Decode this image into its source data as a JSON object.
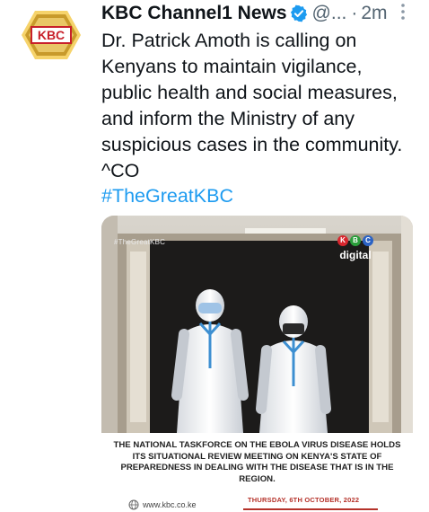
{
  "tweet": {
    "avatar_label": "KBC",
    "display_name": "KBC Channel1 News",
    "handle": "@...",
    "separator": "·",
    "time": "2m",
    "text": "Dr. Patrick Amoth is calling on\nKenyans to maintain vigilance,\npublic health and social measures,\nand inform the Ministry of any\nsuspicious cases in the community.\n^CO",
    "hashtag": "#TheGreatKBC"
  },
  "media": {
    "watermark_tag": "#TheGreatKBC",
    "logo_letters": [
      "K",
      "B",
      "C"
    ],
    "logo_colors": [
      "#d8262e",
      "#2a9d3a",
      "#2b62c4"
    ],
    "logo_word": "digital",
    "caption": "The National Taskforce on the Ebola Virus Disease holds its situational review meeting on Kenya's state of preparedness in dealing with the disease that is in the region.",
    "date": "THURSDAY, 6TH OCTOBER, 2022",
    "website": "www.kbc.co.ke"
  },
  "colors": {
    "link": "#1d9bf0",
    "verified": "#1d9bf0",
    "secondary_text": "#536471",
    "avatar_gold": "#c89a2b",
    "avatar_red": "#c8202a",
    "date_red": "#b5322a"
  },
  "icons": {
    "verified": "verified-badge-icon",
    "more": "more-vertical-icon",
    "globe": "globe-icon"
  }
}
